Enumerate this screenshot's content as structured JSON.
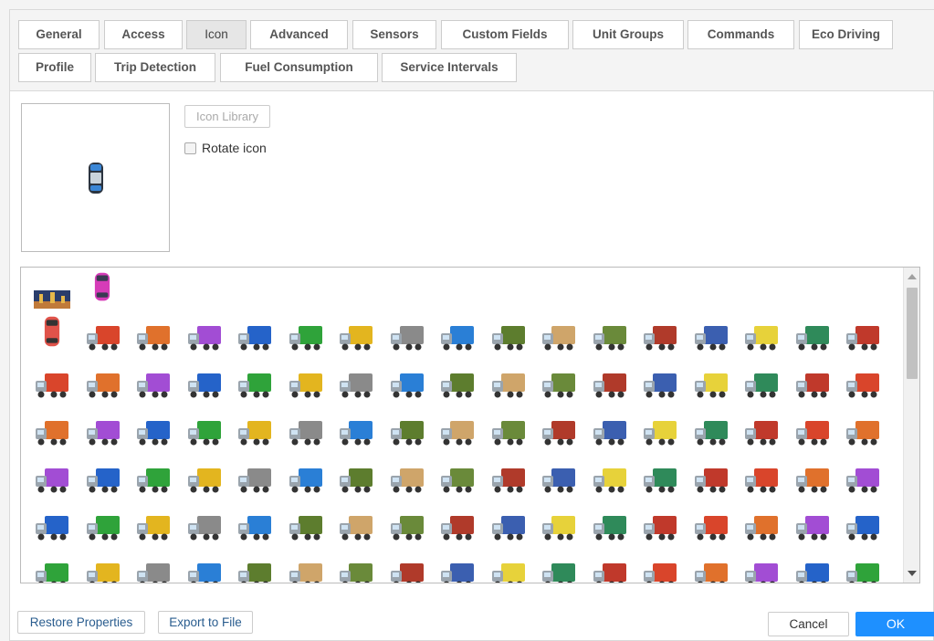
{
  "tabs": [
    {
      "label": "General"
    },
    {
      "label": "Access"
    },
    {
      "label": "Icon"
    },
    {
      "label": "Advanced"
    },
    {
      "label": "Sensors"
    },
    {
      "label": "Custom Fields"
    },
    {
      "label": "Unit Groups"
    },
    {
      "label": "Commands"
    },
    {
      "label": "Eco Driving"
    },
    {
      "label": "Profile"
    },
    {
      "label": "Trip Detection"
    },
    {
      "label": "Fuel Consumption"
    },
    {
      "label": "Service Intervals"
    }
  ],
  "active_tab": "Icon",
  "icon_panel": {
    "library_button": "Icon Library",
    "rotate_label": "Rotate icon",
    "rotate_checked": false,
    "current_icon": "car-top-view-icon"
  },
  "gallery": {
    "row0": [
      "city-image-icon",
      "pink-car-top-view-icon"
    ],
    "palette": [
      "#d9452b",
      "#e0712c",
      "#a24dd4",
      "#2563c9",
      "#2fa33a",
      "#e3b51f",
      "#8a8a8a",
      "#2a7fd6",
      "#5d7d2e",
      "#cfa56a",
      "#6a8a3a",
      "#b03a2a",
      "#3b5fb0",
      "#e7d23a",
      "#2f8a5a",
      "#c0392b"
    ]
  },
  "footer": {
    "restore": "Restore Properties",
    "export": "Export to File",
    "cancel": "Cancel",
    "ok": "OK"
  }
}
